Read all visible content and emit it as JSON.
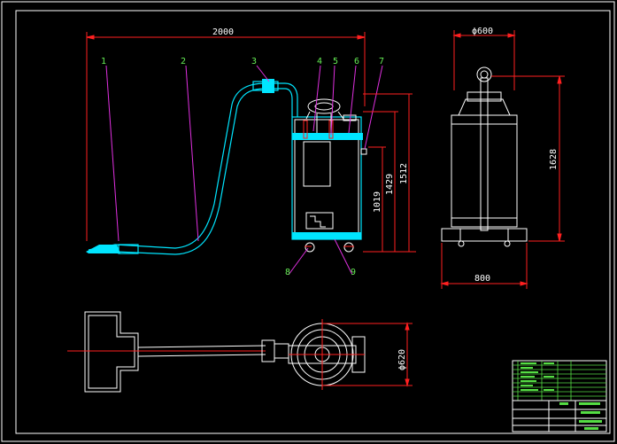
{
  "colors": {
    "background": "#000000",
    "outline": "#ffffff",
    "dimension": "#ff2020",
    "section": "#00e5ff",
    "leader": "#e030e0",
    "balloon_text": "#66ee55",
    "table_text": "#55dd44"
  },
  "dimensions": {
    "overall_length": "2000",
    "top_diameter": "ϕ600",
    "base_width": "800",
    "height_1628": "1628",
    "height_1512": "1512",
    "height_1429": "1429",
    "height_1019": "1019",
    "plan_diameter": "ϕ620"
  },
  "balloons": [
    "1",
    "2",
    "3",
    "4",
    "5",
    "6",
    "7",
    "8",
    "9"
  ]
}
